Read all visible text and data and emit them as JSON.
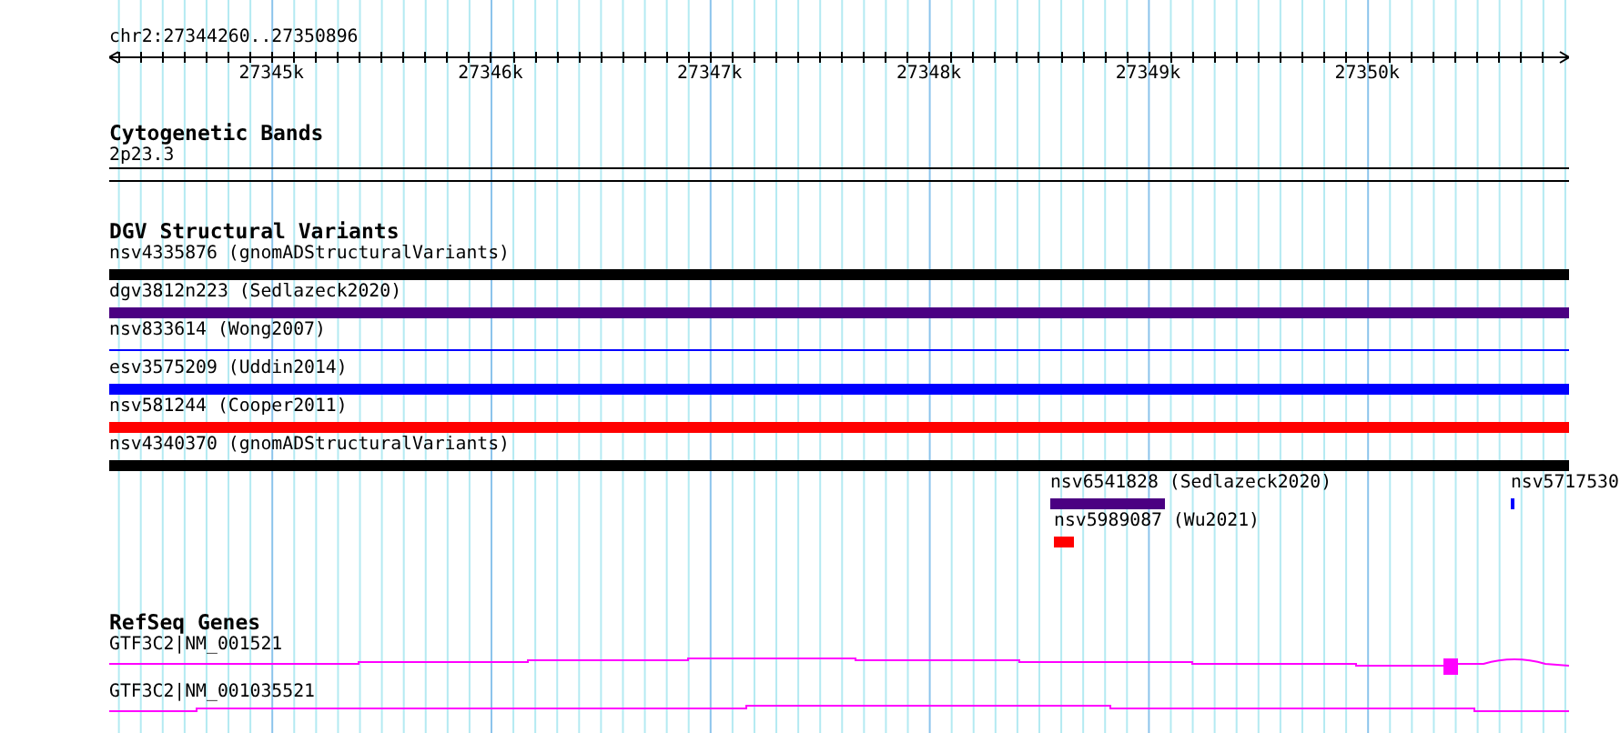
{
  "location": "chr2:27344260..27350896",
  "ruler": {
    "ticks": [
      "27345k",
      "27346k",
      "27347k",
      "27348k",
      "27349k",
      "27350k"
    ]
  },
  "cytoband_track": {
    "title": "Cytogenetic Bands",
    "band": "2p23.3"
  },
  "variant_track": {
    "title": "DGV Structural Variants",
    "rows": [
      [
        {
          "label": "nsv4335876 (gnomADStructuralVariants)",
          "kind": "bar",
          "color": "#000000"
        }
      ],
      [
        {
          "label": "dgv3812n223 (Sedlazeck2020)",
          "kind": "bar",
          "color": "#4b0082"
        }
      ],
      [
        {
          "label": "nsv833614 (Wong2007)",
          "kind": "line",
          "color": "#0000ff"
        }
      ],
      [
        {
          "label": "esv3575209 (Uddin2014)",
          "kind": "bar",
          "color": "#0000ff"
        }
      ],
      [
        {
          "label": "nsv581244 (Cooper2011)",
          "kind": "bar",
          "color": "#ff0000"
        }
      ],
      [
        {
          "label": "nsv4340370 (gnomADStructuralVariants)",
          "kind": "bar",
          "color": "#000000"
        }
      ],
      [
        {
          "label": "nsv6541828 (Sedlazeck2020)",
          "kind": "bar",
          "color": "#4b0082"
        },
        {
          "label": "nsv5717530",
          "kind": "bar",
          "color": "#0000ff"
        }
      ],
      [
        {
          "label": "nsv5989087 (Wu2021)",
          "kind": "bar",
          "color": "#ff0000"
        }
      ]
    ]
  },
  "gene_track": {
    "title": "RefSeq Genes",
    "genes": [
      {
        "label": "GTF3C2|NM_001521"
      },
      {
        "label": "GTF3C2|NM_001035521"
      }
    ]
  }
}
